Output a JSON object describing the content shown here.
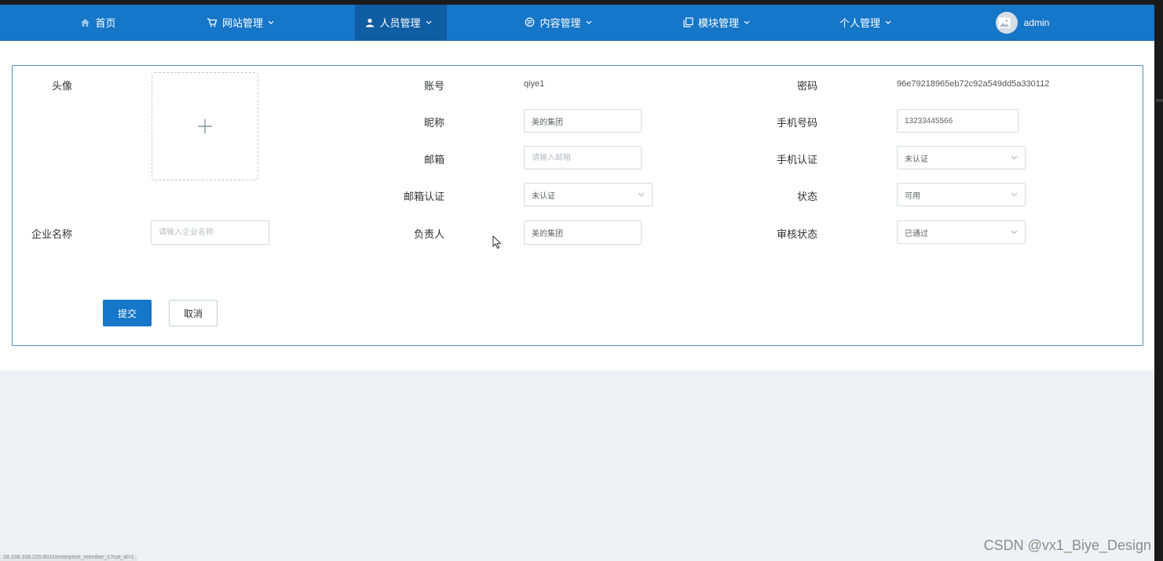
{
  "nav": {
    "items": [
      {
        "label": "首页",
        "icon": "home-icon"
      },
      {
        "label": "网站管理",
        "icon": "cart-icon"
      },
      {
        "label": "人员管理",
        "icon": "user-icon"
      },
      {
        "label": "内容管理",
        "icon": "chat-icon"
      },
      {
        "label": "模块管理",
        "icon": "copy-icon"
      },
      {
        "label": "个人管理",
        "icon": ""
      }
    ],
    "active": "人员管理",
    "user": "admin"
  },
  "form": {
    "avatar_label": "头像",
    "account_label": "账号",
    "account_value": "qiye1",
    "password_label": "密码",
    "password_value": "96e79218965eb72c92a549dd5a330112",
    "nickname_label": "昵称",
    "nickname_value": "美的集团",
    "phone_label": "手机号码",
    "phone_value": "13233445566",
    "email_label": "邮箱",
    "email_placeholder": "请输入邮箱",
    "phone_verify_label": "手机认证",
    "phone_verify_value": "未认证",
    "email_verify_label": "邮箱认证",
    "email_verify_value": "未认证",
    "status_label": "状态",
    "status_value": "可用",
    "company_label": "企业名称",
    "company_placeholder": "请输入企业名称",
    "manager_label": "负责人",
    "manager_value": "美的集团",
    "audit_label": "审核状态",
    "audit_value": "已通过"
  },
  "buttons": {
    "submit": "提交",
    "cancel": "取消"
  },
  "watermark": "CSDN @vx1_Biye_Design",
  "statusbar": "28.108.108.225:8011/enterprise_member_1?cat_id=1",
  "colors": {
    "nav_bg": "#1676c8",
    "nav_active_bg": "#0f5ea3",
    "primary_button": "#1676c8",
    "card_border": "#4a8fc4",
    "page_bg": "#f0f1f4"
  }
}
